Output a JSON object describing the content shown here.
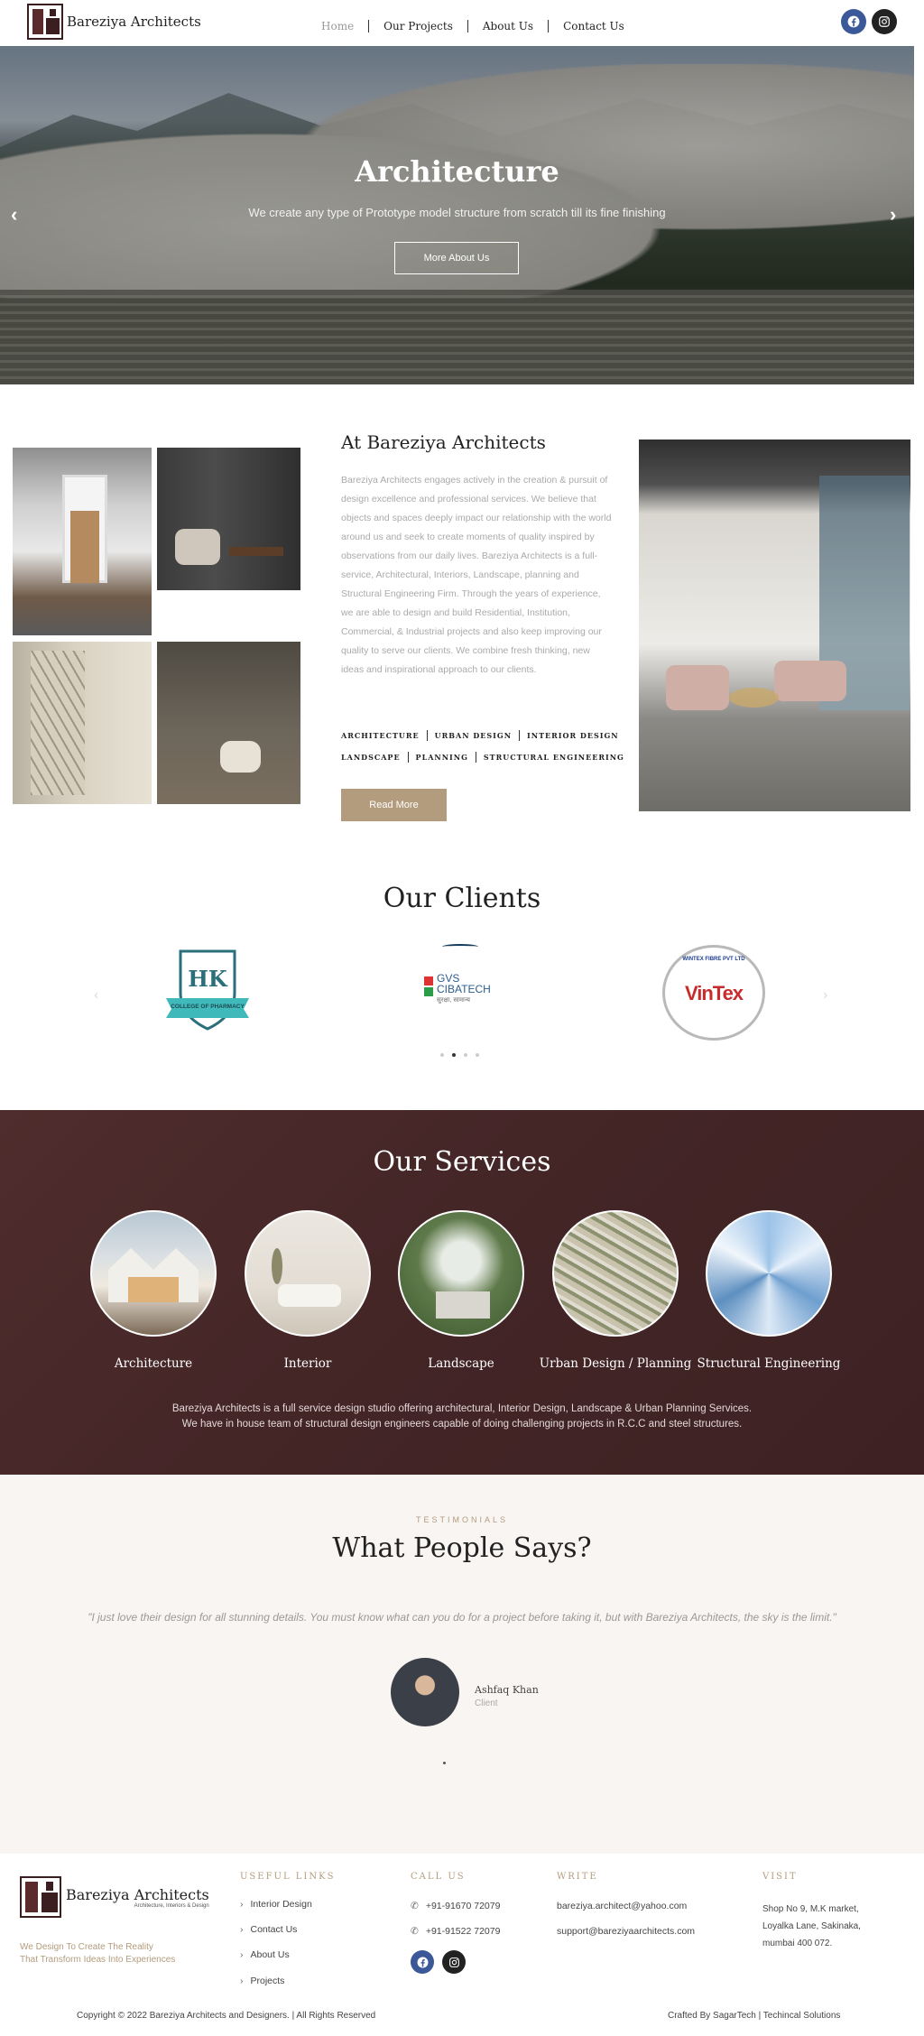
{
  "header": {
    "brand": "Bareziya Architects",
    "nav": [
      "Home",
      "Our Projects",
      "About Us",
      "Contact Us"
    ],
    "active_nav": "Home",
    "social": [
      "facebook-icon",
      "instagram-icon"
    ]
  },
  "hero": {
    "title": "Architecture",
    "subtitle": "We create any type of Prototype model structure from scratch till its fine finishing",
    "button": "More About Us"
  },
  "about": {
    "title": "At Bareziya Architects",
    "text": "Bareziya Architects engages actively in the creation & pursuit of design excellence and professional services. We believe that objects and spaces deeply impact our relationship with the world around us and seek to create moments of quality inspired by observations from our daily lives. Bareziya Architects is a full-service, Architectural, Interiors, Landscape, planning and Structural Engineering Firm. Through the years of experience, we are able to design and build Residential, Institution, Commercial, & Industrial projects and also keep improving our quality to serve our clients. We combine fresh thinking, new ideas and inspirational approach to our clients.",
    "tags_row1": [
      "ARCHITECTURE",
      "URBAN DESIGN",
      "INTERIOR DESIGN"
    ],
    "tags_row2": [
      "LANDSCAPE",
      "PLANNING",
      "STRUCTURAL ENGINEERING"
    ],
    "button": "Read More"
  },
  "clients": {
    "title": "Our Clients",
    "logos": [
      {
        "name": "HK College of Pharmacy",
        "text": "HK",
        "sub": "COLLEGE OF PHARMACY"
      },
      {
        "name": "GVS Cibatech",
        "text": "GVS CIBATECH",
        "sub": "सुरक्षा, सामान्य"
      },
      {
        "name": "VinTex",
        "text": "VinTex",
        "sub": "WINTEX FIBRE PVT LTD"
      }
    ],
    "active_dot": 1,
    "dot_count": 4
  },
  "services": {
    "title": "Our Services",
    "items": [
      "Architecture",
      "Interior",
      "Landscape",
      "Urban Design / Planning",
      "Structural Engineering"
    ],
    "desc_line1": "Bareziya Architects is a full service design studio offering architectural, Interior Design, Landscape & Urban Planning Services.",
    "desc_line2": "We have in house team of structural design engineers capable of doing challenging projects in R.C.C and steel structures."
  },
  "testimonials": {
    "eyebrow": "TESTIMONIALS",
    "title": "What People Says?",
    "quote": "\"I just love their design for all stunning details. You must know what can you do for a project before taking it, but with Bareziya Architects, the sky is the limit.\"",
    "name": "Ashfaq Khan",
    "role": "Client"
  },
  "footer": {
    "brand": "Bareziya Architects",
    "brand_sub": "Architecture, Interiors & Design",
    "tagline_1": "We Design To Create The Reality",
    "tagline_2": "That Transform Ideas Into Experiences",
    "useful_links_title": "USEFUL LINKS",
    "useful_links": [
      "Interior Design",
      "Contact Us",
      "About Us",
      "Projects"
    ],
    "call_title": "CALL US",
    "phones": [
      "+91-91670 72079",
      "+91-91522 72079"
    ],
    "write_title": "WRITE",
    "emails": [
      "bareziya.architect@yahoo.com",
      "support@bareziyaarchitects.com"
    ],
    "visit_title": "VISIT",
    "address": [
      "Shop No 9, M.K market,",
      "Loyalka Lane, Sakinaka,",
      "mumbai 400 072."
    ],
    "copyright": "Copyright © 2022 Bareziya Architects and Designers. | All Rights Reserved",
    "credit": "Crafted By SagarTech | Techincal Solutions"
  },
  "colors": {
    "accent_gold": "#b39c7d",
    "services_bg": "#4a2a2b",
    "facebook": "#3b5998",
    "instagram": "#222222"
  }
}
